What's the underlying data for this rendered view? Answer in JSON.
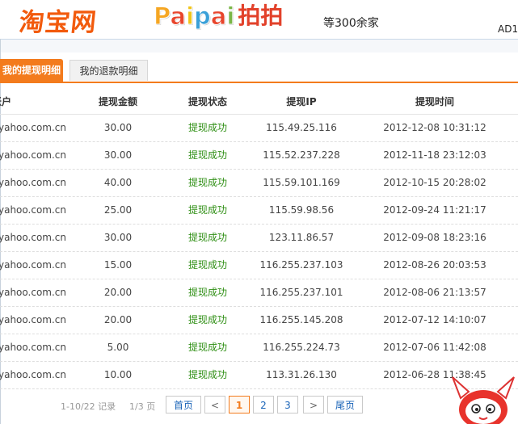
{
  "banner": {
    "taobao_logo_text": "淘宝网",
    "paipai_letters": [
      {
        "ch": "P",
        "color": "#f5a623"
      },
      {
        "ch": "a",
        "color": "#e8452c"
      },
      {
        "ch": "i",
        "color": "#f0c419"
      },
      {
        "ch": "p",
        "color": "#3aa0d8"
      },
      {
        "ch": "a",
        "color": "#e8452c"
      },
      {
        "ch": "i",
        "color": "#7ab648"
      }
    ],
    "paipai_cn": "拍拍",
    "slogan": "等300余家",
    "ad_text": "AD1"
  },
  "tabs": {
    "active_label": "我的提现明细",
    "other_label": "我的退款明细"
  },
  "table": {
    "headers": {
      "account": "账户",
      "amount": "提现金额",
      "status": "提现状态",
      "ip": "提现IP",
      "time": "提现时间"
    },
    "rows": [
      {
        "account": "yahoo.com.cn",
        "amount": "30.00",
        "status": "提现成功",
        "ip": "115.49.25.116",
        "time": "2012-12-08 10:31:12"
      },
      {
        "account": "yahoo.com.cn",
        "amount": "30.00",
        "status": "提现成功",
        "ip": "115.52.237.228",
        "time": "2012-11-18 23:12:03"
      },
      {
        "account": "yahoo.com.cn",
        "amount": "40.00",
        "status": "提现成功",
        "ip": "115.59.101.169",
        "time": "2012-10-15 20:28:02"
      },
      {
        "account": "yahoo.com.cn",
        "amount": "25.00",
        "status": "提现成功",
        "ip": "115.59.98.56",
        "time": "2012-09-24 11:21:17"
      },
      {
        "account": "yahoo.com.cn",
        "amount": "30.00",
        "status": "提现成功",
        "ip": "123.11.86.57",
        "time": "2012-09-08 18:23:16"
      },
      {
        "account": "yahoo.com.cn",
        "amount": "15.00",
        "status": "提现成功",
        "ip": "116.255.237.103",
        "time": "2012-08-26 20:03:53"
      },
      {
        "account": "yahoo.com.cn",
        "amount": "20.00",
        "status": "提现成功",
        "ip": "116.255.237.101",
        "time": "2012-08-06 21:13:57"
      },
      {
        "account": "yahoo.com.cn",
        "amount": "20.00",
        "status": "提现成功",
        "ip": "116.255.145.208",
        "time": "2012-07-12 14:10:07"
      },
      {
        "account": "yahoo.com.cn",
        "amount": "5.00",
        "status": "提现成功",
        "ip": "116.255.224.73",
        "time": "2012-07-06 11:42:08"
      },
      {
        "account": "yahoo.com.cn",
        "amount": "10.00",
        "status": "提现成功",
        "ip": "113.31.26.130",
        "time": "2012-06-28 11:38:45"
      }
    ]
  },
  "pager": {
    "info": "1-10/22 记录",
    "pages": "1/3 页",
    "first_label": "首页",
    "prev_label": "<",
    "page_buttons": [
      "1",
      "2",
      "3"
    ],
    "current_page": "1",
    "next_label": ">",
    "last_label": "尾页"
  },
  "colors": {
    "accent": "#f37b1d",
    "success": "#2f8f14",
    "link": "#1a64b8"
  }
}
